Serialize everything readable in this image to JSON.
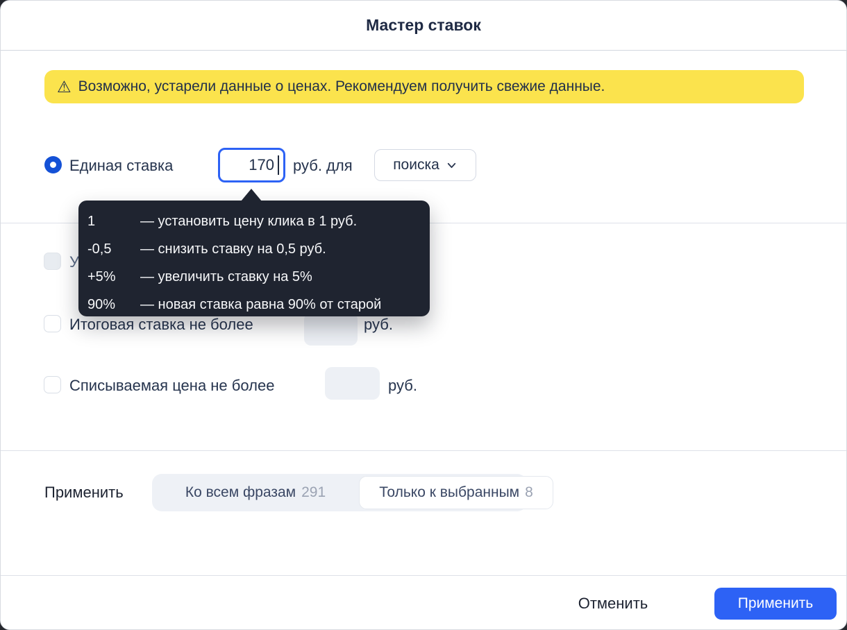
{
  "dialog": {
    "title": "Мастер ставок",
    "warning": {
      "icon": "warning-triangle-icon",
      "text": "Возможно, устарели данные о ценах. Рекомендуем получить свежие данные."
    },
    "bid": {
      "radio_label": "Единая ставка",
      "radio_checked": true,
      "amount_value": "170",
      "unit_label": "руб. для",
      "target_select_value": "поиска"
    },
    "tooltip": {
      "rows": [
        {
          "term": "1",
          "desc": "— установить цену клика в 1 руб."
        },
        {
          "term": "-0,5",
          "desc": "— снизить ставку на 0,5 руб."
        },
        {
          "term": "+5%",
          "desc": "— увеличить ставку на 5%"
        },
        {
          "term": "90%",
          "desc": "— новая ставка равна 90% от старой"
        }
      ]
    },
    "limits": {
      "hidden_row": {
        "visible_label": "У",
        "checked": false
      },
      "rows": [
        {
          "label": "Итоговая ставка не более",
          "value": "",
          "unit": "руб.",
          "checked": false
        },
        {
          "label": "Списываемая цена не более",
          "value": "",
          "unit": "руб.",
          "checked": false
        }
      ]
    },
    "apply_to": {
      "label": "Применить",
      "segments": [
        {
          "label": "Ко всем фразам",
          "count": "291",
          "selected": false
        },
        {
          "label": "Только к выбранным",
          "count": "8",
          "selected": true
        }
      ]
    },
    "footer": {
      "cancel_label": "Отменить",
      "apply_label": "Применить"
    },
    "colors": {
      "accent": "#2d62f5",
      "radio_blue": "#1451d6",
      "warning_bg": "#fbe34d",
      "tooltip_bg": "#1f2430"
    }
  }
}
